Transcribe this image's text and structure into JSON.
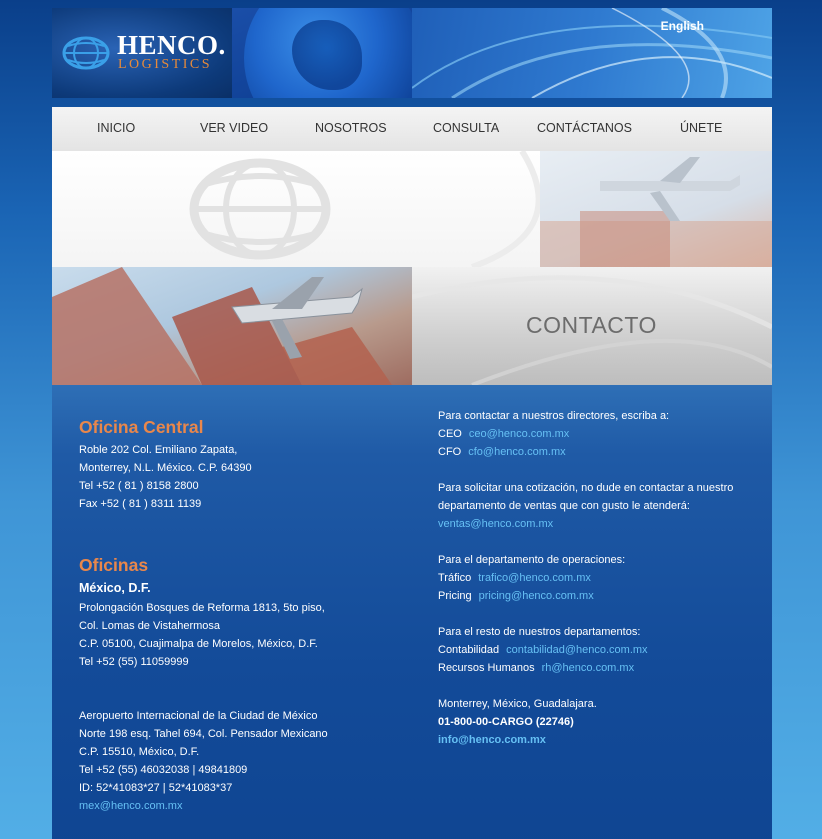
{
  "header": {
    "brand": "HENCO.",
    "brand_sub": "LOGISTICS",
    "language_link": "English"
  },
  "nav": {
    "items": [
      "INICIO",
      "VER VIDEO",
      "NOSOTROS",
      "CONSULTA",
      "CONTÁCTANOS",
      "ÚNETE"
    ]
  },
  "banner": {
    "title": "CONTACTO"
  },
  "left": {
    "central_heading": "Oficina Central",
    "central_lines": [
      "Roble 202 Col. Emiliano Zapata,",
      "Monterrey, N.L. México. C.P. 64390",
      "Tel +52 ( 81 ) 8158 2800",
      "Fax +52 ( 81 ) 8311 1139"
    ],
    "offices_heading": "Oficinas",
    "df_heading": "México, D.F.",
    "df_lines": [
      "Prolongación Bosques de Reforma 1813, 5to piso,",
      "Col. Lomas de Vistahermosa",
      "C.P. 05100, Cuajimalpa de Morelos, México, D.F.",
      "Tel +52 (55) 11059999"
    ],
    "airport_lines": [
      "Aeropuerto Internacional de la Ciudad de México",
      "Norte 198 esq. Tahel 694, Col. Pensador Mexicano",
      "C.P. 15510, México, D.F.",
      "Tel +52 (55) 46032038 | 49841809",
      "ID: 52*41083*27 | 52*41083*37"
    ],
    "airport_email": "mex@henco.com.mx"
  },
  "right": {
    "directors_intro": "Para contactar a nuestros directores, escriba a:",
    "ceo_label": "CEO",
    "ceo_email": "ceo@henco.com.mx",
    "cfo_label": "CFO",
    "cfo_email": "cfo@henco.com.mx",
    "quote_intro_1": "Para solicitar una cotización, no dude en contactar a nuestro",
    "quote_intro_2": "departamento de ventas que con gusto le atenderá:",
    "sales_email": "ventas@henco.com.mx",
    "ops_intro": "Para el departamento de operaciones:",
    "traffic_label": "Tráfico",
    "traffic_email": "trafico@henco.com.mx",
    "pricing_label": "Pricing",
    "pricing_email": "pricing@henco.com.mx",
    "other_intro": "Para el resto de nuestros departamentos:",
    "accounting_label": "Contabilidad",
    "accounting_email": "contabilidad@henco.com.mx",
    "hr_label": "Recursos Humanos",
    "hr_email": "rh@henco.com.mx",
    "cities": "Monterrey, México, Guadalajara.",
    "phone": "01-800-00-CARGO (22746)",
    "info_email": "info@henco.com.mx"
  },
  "colors": {
    "accent_orange": "#e9874b",
    "link_blue": "#66c0f4",
    "content_blue": "#134b99"
  }
}
